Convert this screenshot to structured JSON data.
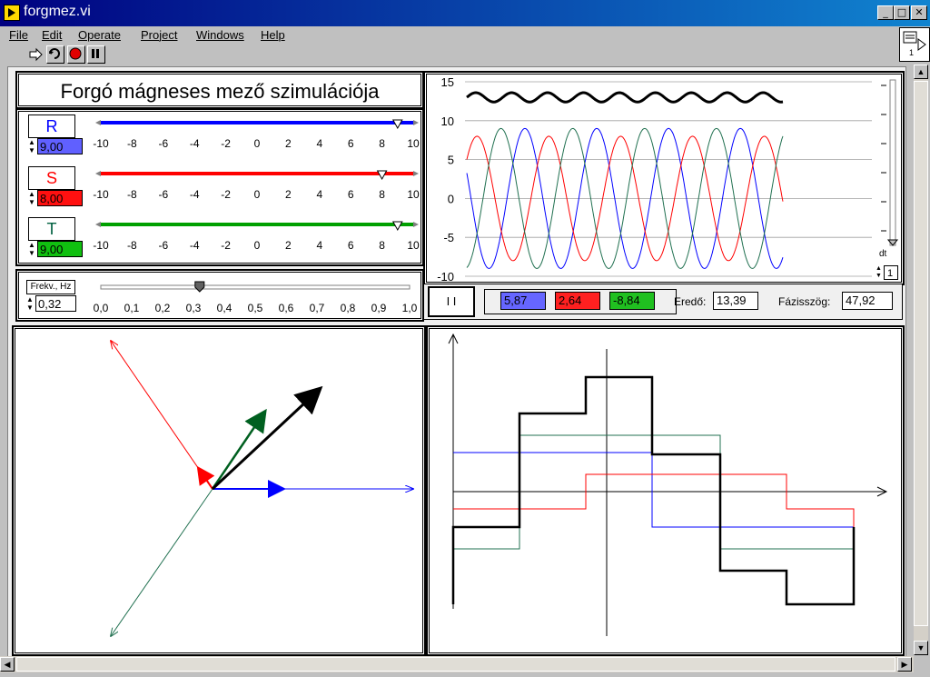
{
  "window": {
    "title": "forgmez.vi"
  },
  "menu": [
    "File",
    "Edit",
    "Operate",
    "Project",
    "Windows",
    "Help"
  ],
  "toolbar": {
    "icons": [
      "run-arrow-icon",
      "run-continuous-icon",
      "abort-icon",
      "pause-icon"
    ]
  },
  "connector": {
    "label": "1"
  },
  "panel": {
    "heading": "Forgó mágneses mező szimulációja",
    "phases": [
      {
        "name": "R",
        "value": "9,00",
        "amplitude": 9.0,
        "color": "#0000ff"
      },
      {
        "name": "S",
        "value": "8,00",
        "amplitude": 8.0,
        "color": "#ff0000"
      },
      {
        "name": "T",
        "value": "9,00",
        "amplitude": 9.0,
        "color": "#00a000"
      }
    ],
    "phase_ticks": [
      "-10",
      "-8",
      "-6",
      "-4",
      "-2",
      "0",
      "2",
      "4",
      "6",
      "8",
      "10"
    ],
    "freq": {
      "label": "Frekv., Hz",
      "value": "0,32",
      "level": 0.32,
      "ticks": [
        "0,0",
        "0,1",
        "0,2",
        "0,3",
        "0,4",
        "0,5",
        "0,6",
        "0,7",
        "0,8",
        "0,9",
        "1,0"
      ]
    },
    "pause_button": "I I",
    "instant": [
      {
        "value": "5,87",
        "color": "#6666ff"
      },
      {
        "value": "2,64",
        "color": "#ff2020"
      },
      {
        "value": "-8,84",
        "color": "#20c020"
      }
    ],
    "ered_label": "Eredő:",
    "ered_value": "13,39",
    "faz_label": "Fázisszög:",
    "faz_value": "47,92",
    "dt_label": "dt",
    "dt_value": "1"
  },
  "chart_data": [
    {
      "type": "line",
      "y_ticks": [
        "15",
        "10",
        "5",
        "0",
        "-5",
        "-10"
      ],
      "ylim": [
        -10,
        15
      ],
      "grid": true,
      "series": [
        {
          "color": "#0000ff",
          "amplitude": 9,
          "phase_deg": 0
        },
        {
          "color": "#ff0000",
          "amplitude": 8,
          "phase_deg": 120
        },
        {
          "color": "#207050",
          "amplitude": 9,
          "phase_deg": 240
        },
        {
          "color": "#000000",
          "kind": "resultant",
          "mean": 13,
          "ripple": 0.6
        }
      ]
    }
  ]
}
